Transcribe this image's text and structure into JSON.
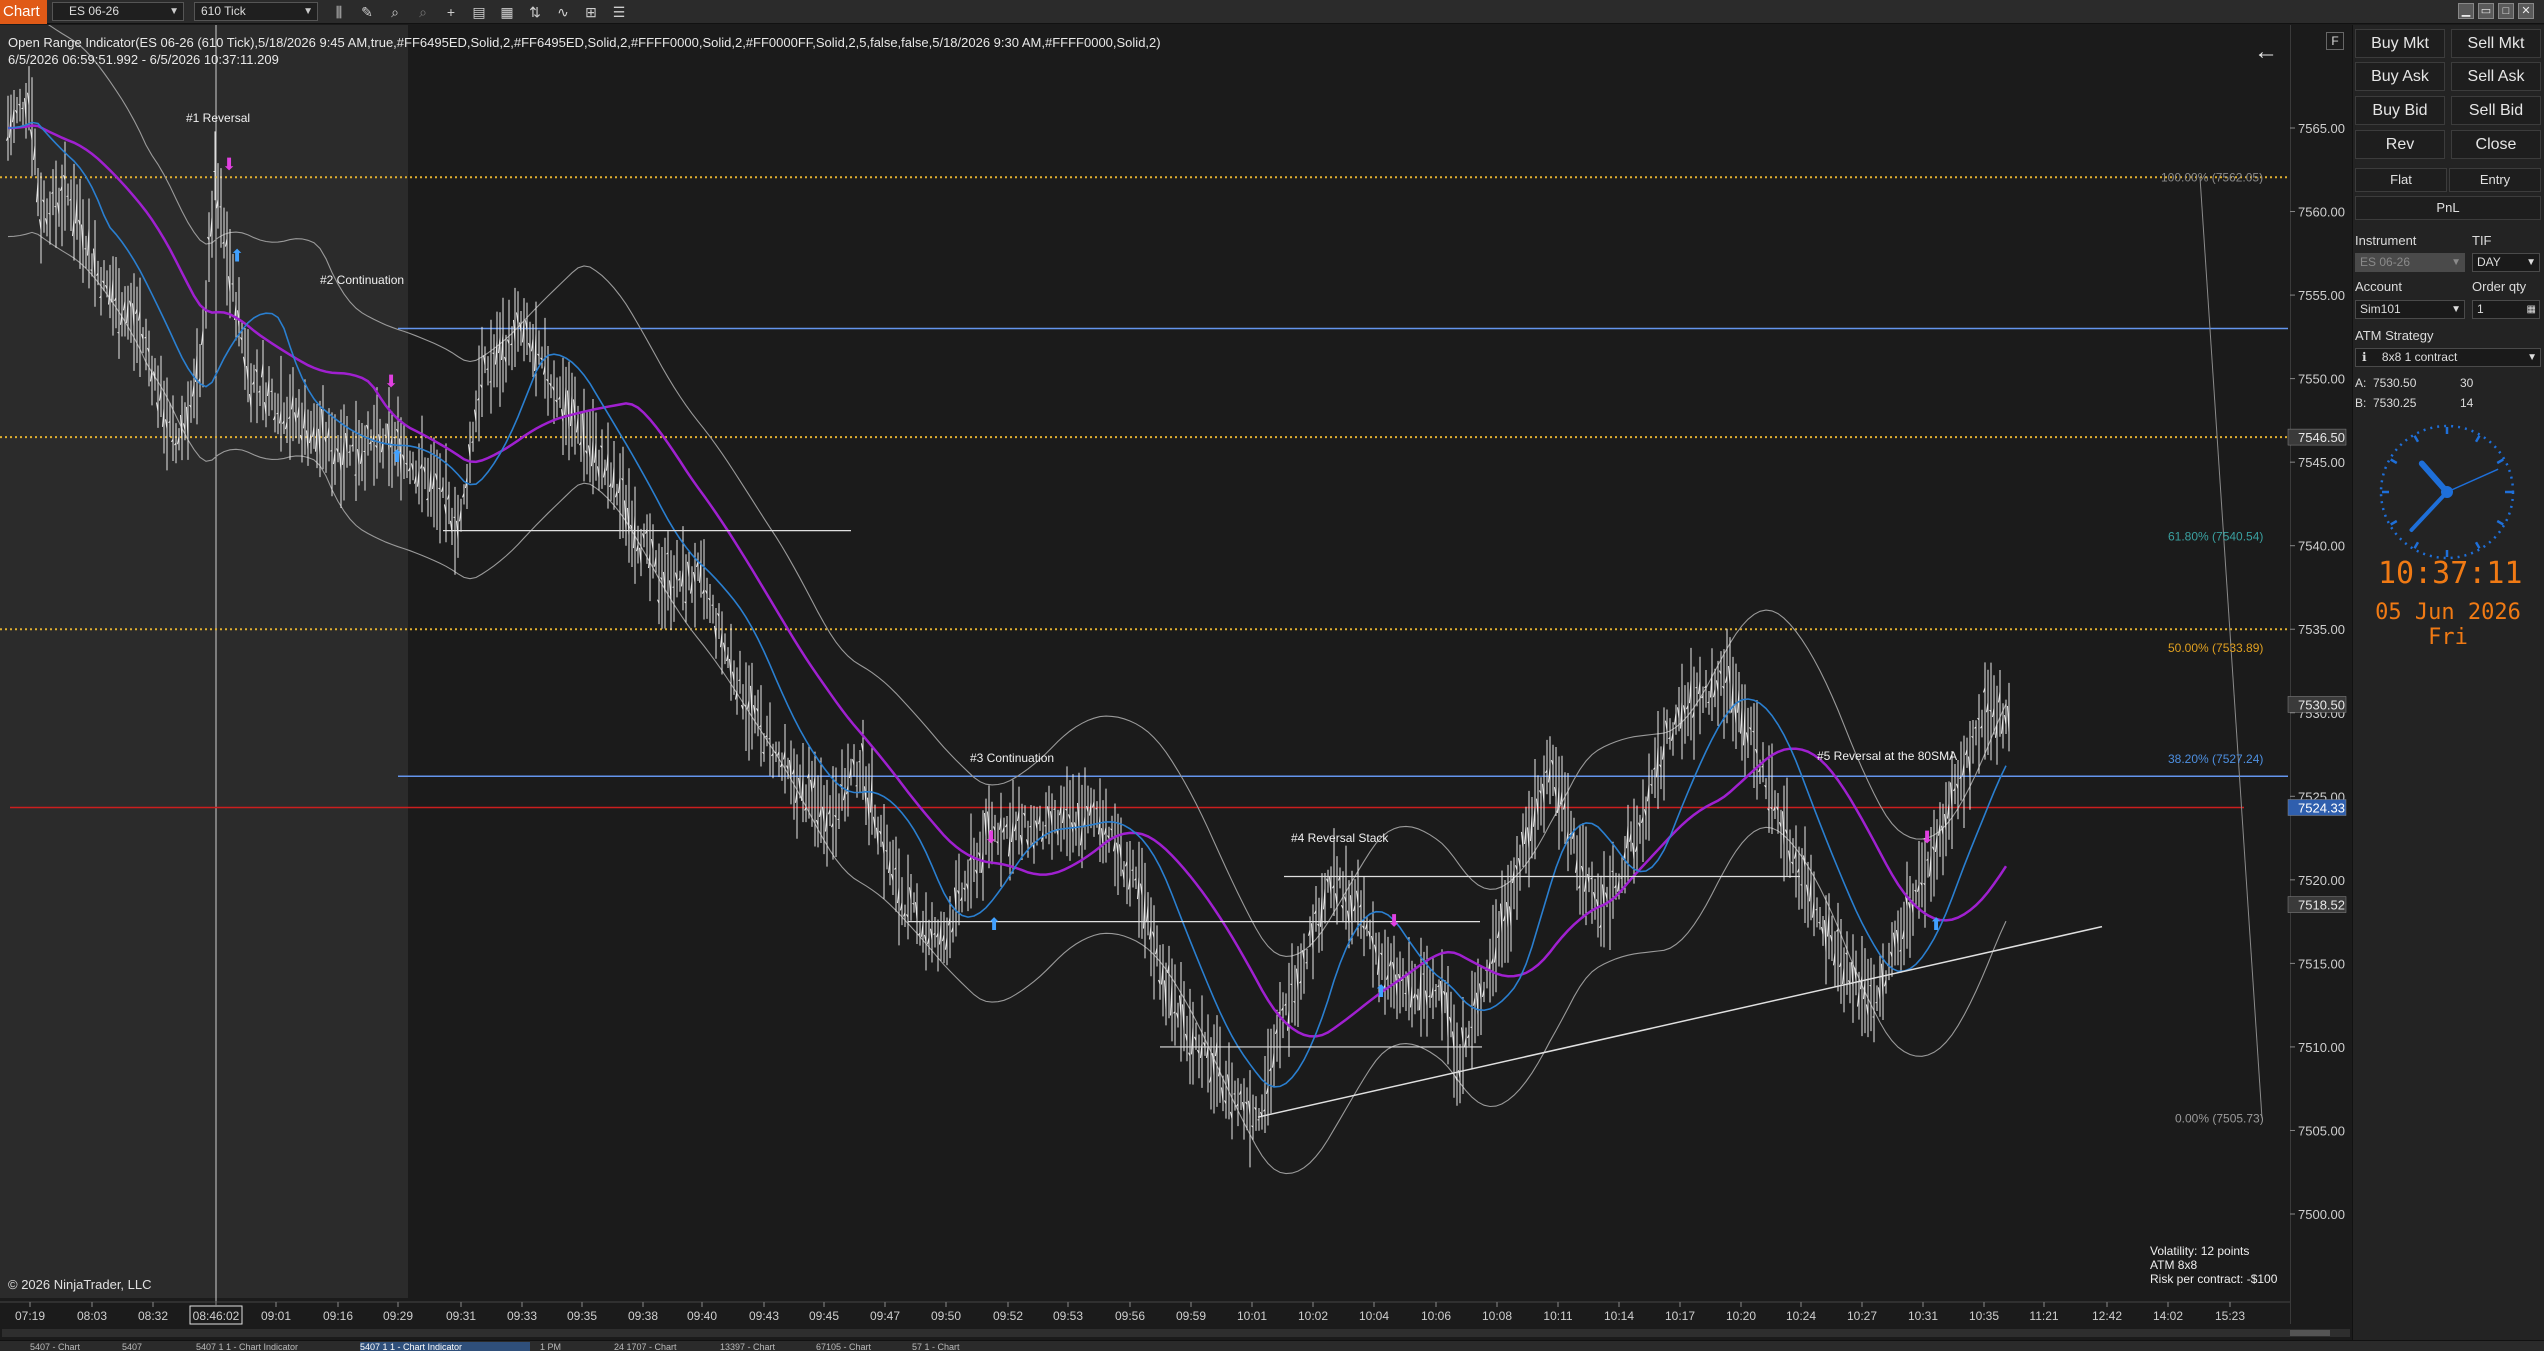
{
  "toolbar": {
    "chart_tab": "Chart",
    "instrument": "ES 06-26",
    "period": "610 Tick",
    "icons": [
      "bar-type-icon",
      "draw-pencil-icon",
      "zoom-icon",
      "zoom-out-icon",
      "crosshair-icon",
      "data-box-icon",
      "properties-icon",
      "strategies-icon",
      "indicators-icon",
      "drawing-tools-icon",
      "templates-icon",
      "chart-trader-icon"
    ],
    "window_controls": [
      "minimize-icon",
      "restore-icon",
      "maximize-icon",
      "close-icon"
    ]
  },
  "chart": {
    "indicator_label": "Open Range Indicator(ES 06-26 (610 Tick),5/18/2026 9:45 AM,true,#FF6495ED,Solid,2,#FF6495ED,Solid,2,#FFFF0000,Solid,2,#FF0000FF,Solid,2,5,false,false,5/18/2026 9:30 AM,#FFFF0000,Solid,2)",
    "date_range": "6/5/2026 06:59:51.992 - 6/5/2026 10:37:11.209",
    "copyright": "© 2026 NinjaTrader, LLC",
    "back_arrow": "←",
    "f_button": "F",
    "volatility_lines": [
      "Volatility: 12 points",
      "ATM 8x8",
      "Risk per contract: -$100"
    ],
    "annotations": [
      {
        "id": "a1",
        "text": "#1 Reversal"
      },
      {
        "id": "a2",
        "text": "#2 Continuation"
      },
      {
        "id": "a3",
        "text": "#3 Continuation"
      },
      {
        "id": "a4",
        "text": "#4 Reversal Stack"
      },
      {
        "id": "a5",
        "text": "#5 Reversal at the 80SMA"
      }
    ],
    "fib_labels": [
      {
        "text": "100.00% (7562.05)",
        "price": 7562.05,
        "color": "#8a8a8a"
      },
      {
        "text": "61.80% (7540.54)",
        "price": 7540.54,
        "color": "#3aa0a0"
      },
      {
        "text": "50.00% (7533.89)",
        "price": 7533.89,
        "color": "#e0a020"
      },
      {
        "text": "38.20% (7527.24)",
        "price": 7527.24,
        "color": "#4d8fe0"
      },
      {
        "text": "0.00% (7505.73)",
        "price": 7505.73,
        "color": "#9a9a9a"
      }
    ],
    "price_ticks": [
      "7565.00",
      "7560.00",
      "7555.00",
      "7550.00",
      "7545.00",
      "7540.00",
      "7535.00",
      "7530.00",
      "7525.00",
      "7520.00",
      "7515.00",
      "7510.00",
      "7505.00",
      "7500.00"
    ],
    "price_tick_values": [
      7565,
      7560,
      7555,
      7550,
      7545,
      7540,
      7535,
      7530,
      7525,
      7520,
      7515,
      7510,
      7505,
      7500
    ],
    "price_markers": [
      {
        "text": "7546.50",
        "price": 7546.5,
        "bg": "#3a3a3a",
        "fg": "#e8e8e8"
      },
      {
        "text": "7530.50",
        "price": 7530.5,
        "bg": "#3a3a3a",
        "fg": "#e8e8e8"
      },
      {
        "text": "7524.33",
        "price": 7524.33,
        "bg": "#2f5fae",
        "fg": "#ffffff"
      },
      {
        "text": "7518.52",
        "price": 7518.52,
        "bg": "#3a3a3a",
        "fg": "#e8e8e8"
      }
    ],
    "time_ticks": [
      "07:19",
      "08:03",
      "08:32",
      "08:46:02",
      "09:01",
      "09:16",
      "09:29",
      "09:31",
      "09:33",
      "09:35",
      "09:38",
      "09:40",
      "09:43",
      "09:45",
      "09:47",
      "09:50",
      "09:52",
      "09:53",
      "09:56",
      "09:59",
      "10:01",
      "10:02",
      "10:04",
      "10:06",
      "10:08",
      "10:11",
      "10:14",
      "10:17",
      "10:20",
      "10:24",
      "10:27",
      "10:31",
      "10:35",
      "11:21",
      "12:42",
      "14:02",
      "15:23"
    ],
    "highlighted_time": "08:46:02",
    "horizontal_levels": [
      {
        "price": 7562.05,
        "style": "dotted",
        "color": "#e0b030"
      },
      {
        "price": 7553.0,
        "style": "solid",
        "color": "#6495ed"
      },
      {
        "price": 7546.5,
        "style": "dotted",
        "color": "#e0b030"
      },
      {
        "price": 7535.0,
        "style": "dotted",
        "color": "#e0b030"
      },
      {
        "price": 7526.2,
        "style": "solid",
        "color": "#6495ed"
      },
      {
        "price": 7524.33,
        "style": "solid",
        "color": "#cc1e1e"
      }
    ]
  },
  "bottom_tabs": [
    "5407 - Chart",
    "5407",
    "5407 1 1 - Chart Indicator",
    "5407 1 1 - Chart Indicator",
    "1 PM",
    "24 1707 - Chart",
    "13397 - Chart",
    "67105 - Chart",
    "57 1 - Chart"
  ],
  "trader": {
    "buttons": [
      {
        "id": "buy_mkt",
        "label": "Buy Mkt"
      },
      {
        "id": "sell_mkt",
        "label": "Sell Mkt"
      },
      {
        "id": "buy_ask",
        "label": "Buy Ask"
      },
      {
        "id": "sell_ask",
        "label": "Sell Ask"
      },
      {
        "id": "buy_bid",
        "label": "Buy Bid"
      },
      {
        "id": "sell_bid",
        "label": "Sell Bid"
      },
      {
        "id": "rev",
        "label": "Rev"
      },
      {
        "id": "close",
        "label": "Close"
      }
    ],
    "flat_label": "Flat",
    "entry_label": "Entry",
    "pnl_label": "PnL",
    "instrument_label": "Instrument",
    "instrument_value": "ES 06-26",
    "tif_label": "TIF",
    "tif_value": "DAY",
    "account_label": "Account",
    "account_value": "Sim101",
    "order_qty_label": "Order qty",
    "order_qty_value": "1",
    "atm_label": "ATM Strategy",
    "atm_value": "8x8 1 contract",
    "ask_label": "A:",
    "ask_price": "7530.50",
    "ask_size": "30",
    "bid_label": "B:",
    "bid_price": "7530.25",
    "bid_size": "14",
    "clock_time": "10:37:11",
    "clock_date": "05 Jun 2026 Fri",
    "clock_hour": 10,
    "clock_minute": 37,
    "clock_second": 11
  },
  "colors": {
    "accent": "#e05a17",
    "clock": "#f07a14",
    "sma_purple": "#a020d0",
    "ema_blue": "#2a7fd0",
    "signal_down": "#e040e0",
    "signal_up": "#40a0ff"
  }
}
